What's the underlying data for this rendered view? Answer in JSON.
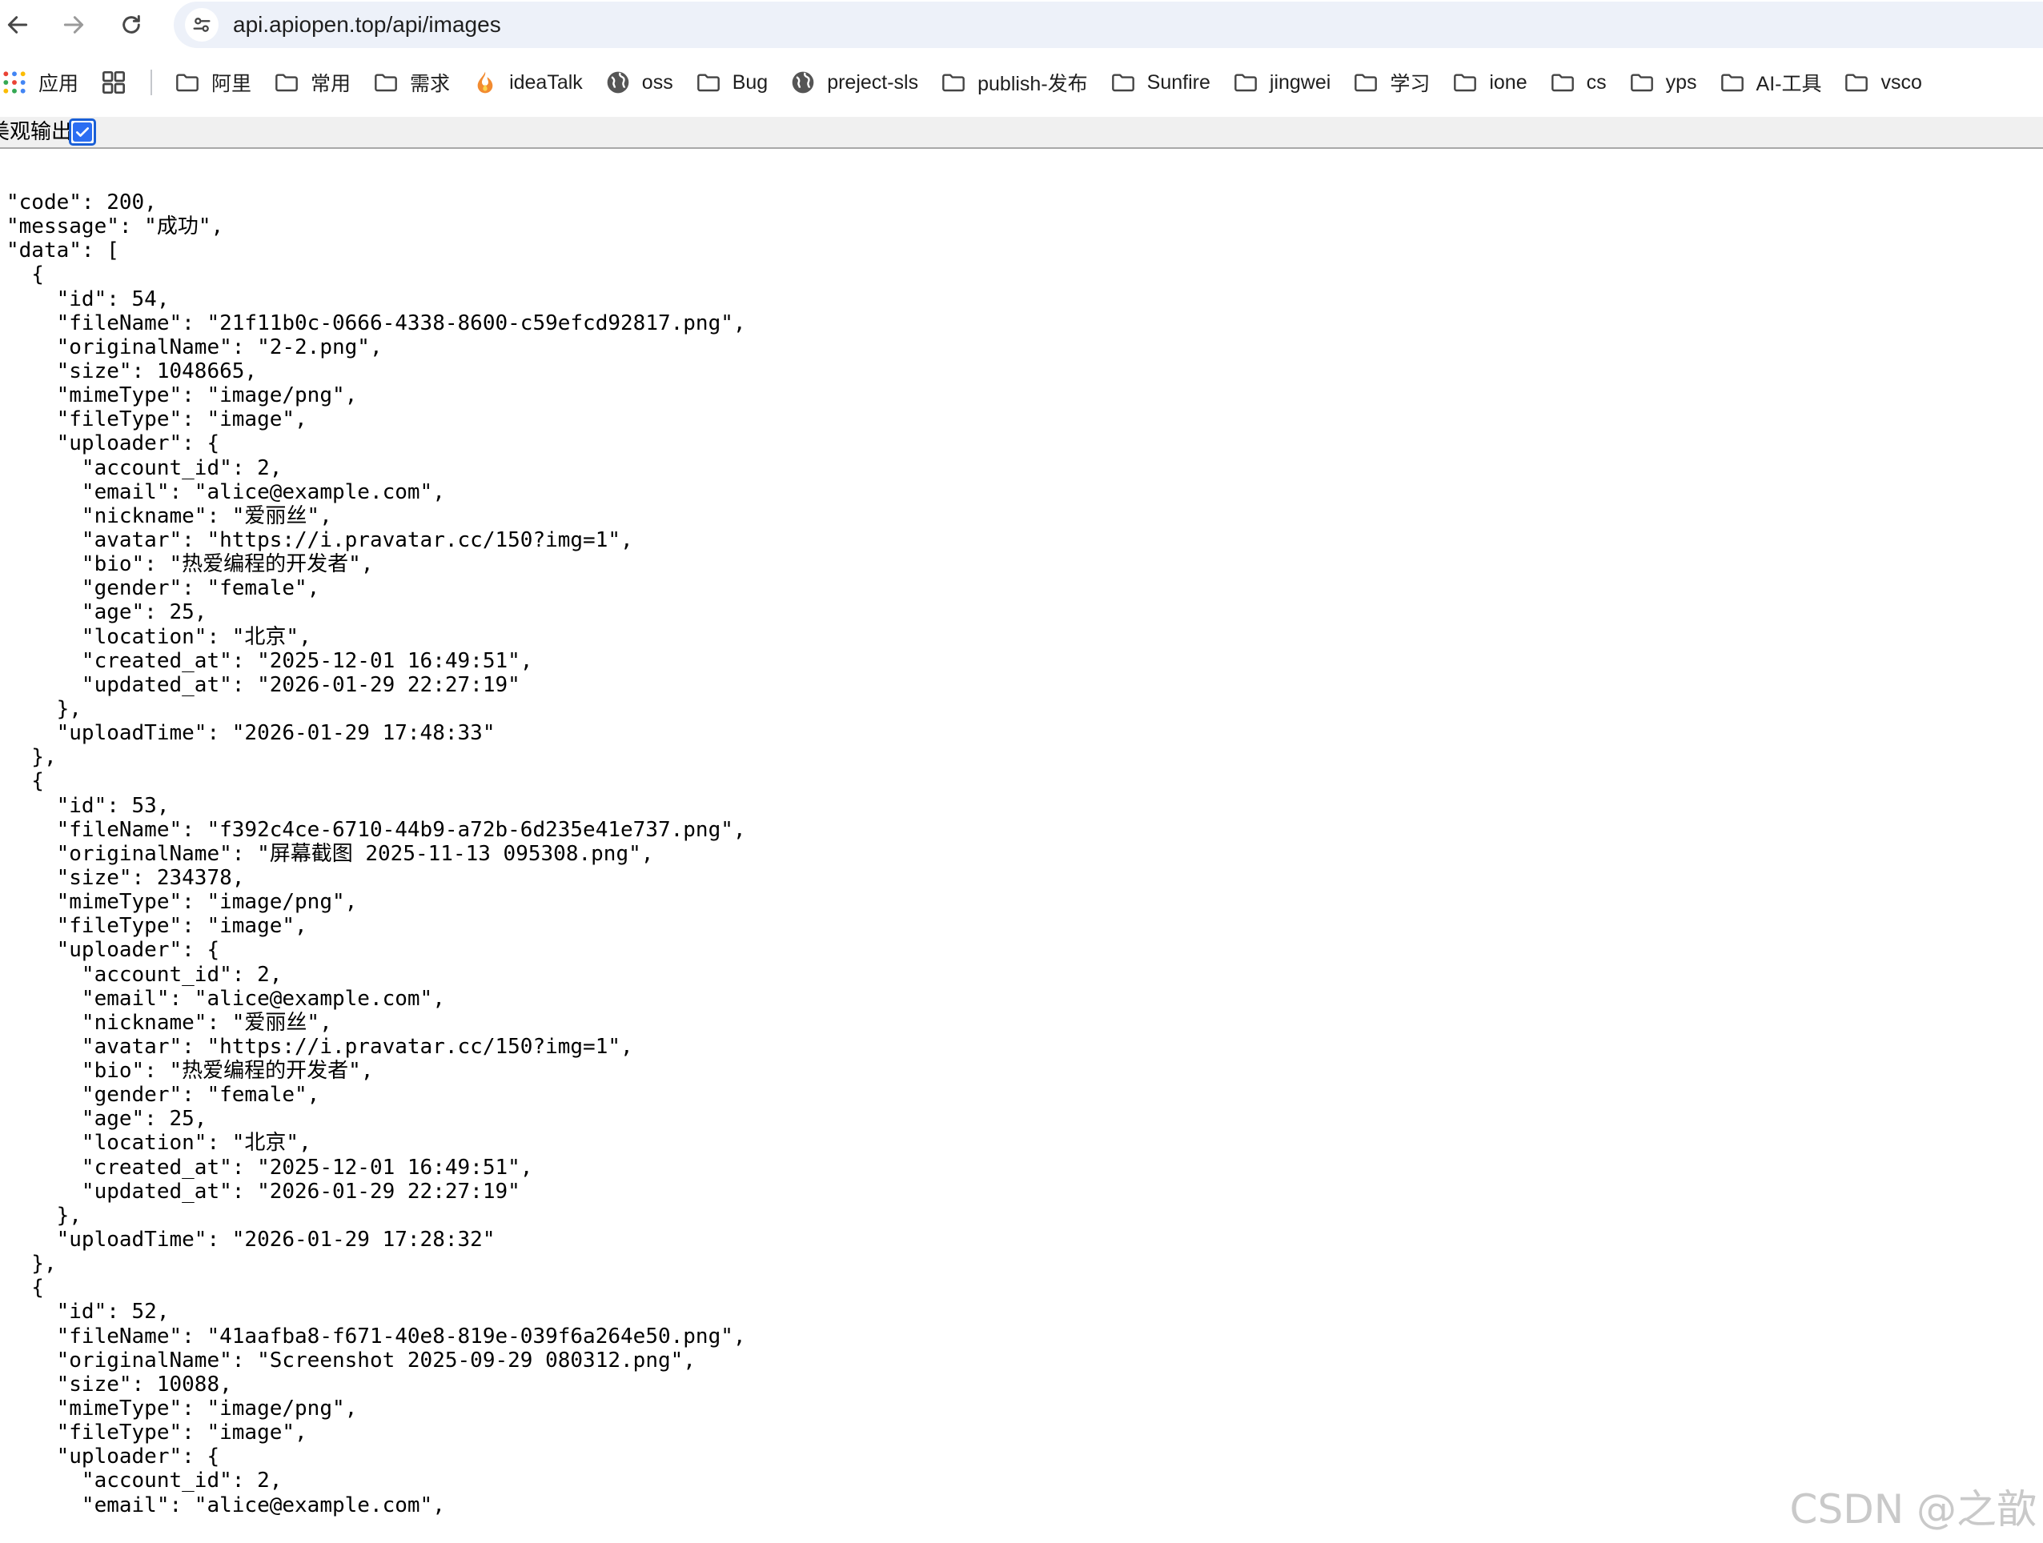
{
  "browser": {
    "url": "api.apiopen.top/api/images",
    "back_icon": "arrow-left-icon",
    "forward_icon": "arrow-right-icon",
    "reload_icon": "reload-icon"
  },
  "bookmarks": [
    {
      "label": "应用",
      "icon": "apps-grid-icon"
    },
    {
      "label": "",
      "icon": "tab-groups-icon"
    },
    {
      "label": "阿里",
      "icon": "folder-icon"
    },
    {
      "label": "常用",
      "icon": "folder-icon"
    },
    {
      "label": "需求",
      "icon": "folder-icon"
    },
    {
      "label": "ideaTalk",
      "icon": "flame-icon"
    },
    {
      "label": "oss",
      "icon": "globe-icon"
    },
    {
      "label": "Bug",
      "icon": "folder-icon"
    },
    {
      "label": "preject-sls",
      "icon": "globe-icon"
    },
    {
      "label": "publish-发布",
      "icon": "folder-icon"
    },
    {
      "label": "Sunfire",
      "icon": "folder-icon"
    },
    {
      "label": "jingwei",
      "icon": "folder-icon"
    },
    {
      "label": "学习",
      "icon": "folder-icon"
    },
    {
      "label": "ione",
      "icon": "folder-icon"
    },
    {
      "label": "cs",
      "icon": "folder-icon"
    },
    {
      "label": "yps",
      "icon": "folder-icon"
    },
    {
      "label": "AI-工具",
      "icon": "folder-icon"
    },
    {
      "label": "vsco",
      "icon": "folder-icon"
    }
  ],
  "viewer": {
    "pretty_label": "美观输出",
    "pretty_checked": true
  },
  "json_lines": [
    "\"code\": 200,",
    "\"message\": \"成功\",",
    "\"data\": [",
    "  {",
    "    \"id\": 54,",
    "    \"fileName\": \"21f11b0c-0666-4338-8600-c59efcd92817.png\",",
    "    \"originalName\": \"2-2.png\",",
    "    \"size\": 1048665,",
    "    \"mimeType\": \"image/png\",",
    "    \"fileType\": \"image\",",
    "    \"uploader\": {",
    "      \"account_id\": 2,",
    "      \"email\": \"alice@example.com\",",
    "      \"nickname\": \"爱丽丝\",",
    "      \"avatar\": \"https://i.pravatar.cc/150?img=1\",",
    "      \"bio\": \"热爱编程的开发者\",",
    "      \"gender\": \"female\",",
    "      \"age\": 25,",
    "      \"location\": \"北京\",",
    "      \"created_at\": \"2025-12-01 16:49:51\",",
    "      \"updated_at\": \"2026-01-29 22:27:19\"",
    "    },",
    "    \"uploadTime\": \"2026-01-29 17:48:33\"",
    "  },",
    "  {",
    "    \"id\": 53,",
    "    \"fileName\": \"f392c4ce-6710-44b9-a72b-6d235e41e737.png\",",
    "    \"originalName\": \"屏幕截图 2025-11-13 095308.png\",",
    "    \"size\": 234378,",
    "    \"mimeType\": \"image/png\",",
    "    \"fileType\": \"image\",",
    "    \"uploader\": {",
    "      \"account_id\": 2,",
    "      \"email\": \"alice@example.com\",",
    "      \"nickname\": \"爱丽丝\",",
    "      \"avatar\": \"https://i.pravatar.cc/150?img=1\",",
    "      \"bio\": \"热爱编程的开发者\",",
    "      \"gender\": \"female\",",
    "      \"age\": 25,",
    "      \"location\": \"北京\",",
    "      \"created_at\": \"2025-12-01 16:49:51\",",
    "      \"updated_at\": \"2026-01-29 22:27:19\"",
    "    },",
    "    \"uploadTime\": \"2026-01-29 17:28:32\"",
    "  },",
    "  {",
    "    \"id\": 52,",
    "    \"fileName\": \"41aafba8-f671-40e8-819e-039f6a264e50.png\",",
    "    \"originalName\": \"Screenshot 2025-09-29 080312.png\",",
    "    \"size\": 10088,",
    "    \"mimeType\": \"image/png\",",
    "    \"fileType\": \"image\",",
    "    \"uploader\": {",
    "      \"account_id\": 2,",
    "      \"email\": \"alice@example.com\","
  ],
  "watermark": "CSDN @之歆",
  "colors": {
    "omnibox_bg": "#edf1f9",
    "checkbox_accent": "#2c6ef2"
  }
}
